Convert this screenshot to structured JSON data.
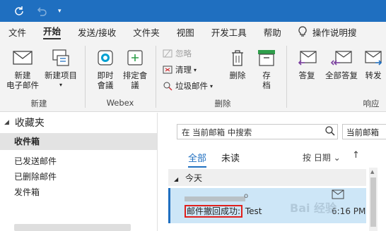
{
  "titlebar": {
    "icons": [
      "sync-icon",
      "undo-icon",
      "qat-customize-icon"
    ]
  },
  "tabs": {
    "items": [
      "文件",
      "开始",
      "发送/接收",
      "文件夹",
      "视图",
      "开发工具",
      "帮助"
    ],
    "active": "开始",
    "tell_me": "操作说明搜"
  },
  "ribbon": {
    "new_email": "新建\n电子邮件",
    "new_items": "新建项目",
    "group_new": "新建",
    "meet_now": "即时\n會議",
    "schedule": "排定會\n議",
    "group_webex": "Webex",
    "ignore": "忽略",
    "cleanup": "清理",
    "junk": "垃圾邮件",
    "delete": "删除",
    "archive": "存\n档",
    "group_delete": "删除",
    "reply": "答复",
    "reply_all": "全部答复",
    "forward": "转发",
    "group_respond": "响应"
  },
  "folders": {
    "favorites": "收藏夹",
    "items": [
      "收件箱",
      "已发送邮件",
      "已删除邮件",
      "发件箱"
    ],
    "selected": "收件箱"
  },
  "list": {
    "search_placeholder": "在 当前邮箱 中搜索",
    "scope": "当前邮箱",
    "filter_all": "全部",
    "filter_unread": "未读",
    "sort": "按 日期",
    "group_today": "今天",
    "mail": {
      "sender_tail": "o",
      "subject_highlight": "邮件撤回成功:",
      "subject_rest": " Test",
      "time": "6:16 PM"
    },
    "watermark": "Bai 经验"
  }
}
